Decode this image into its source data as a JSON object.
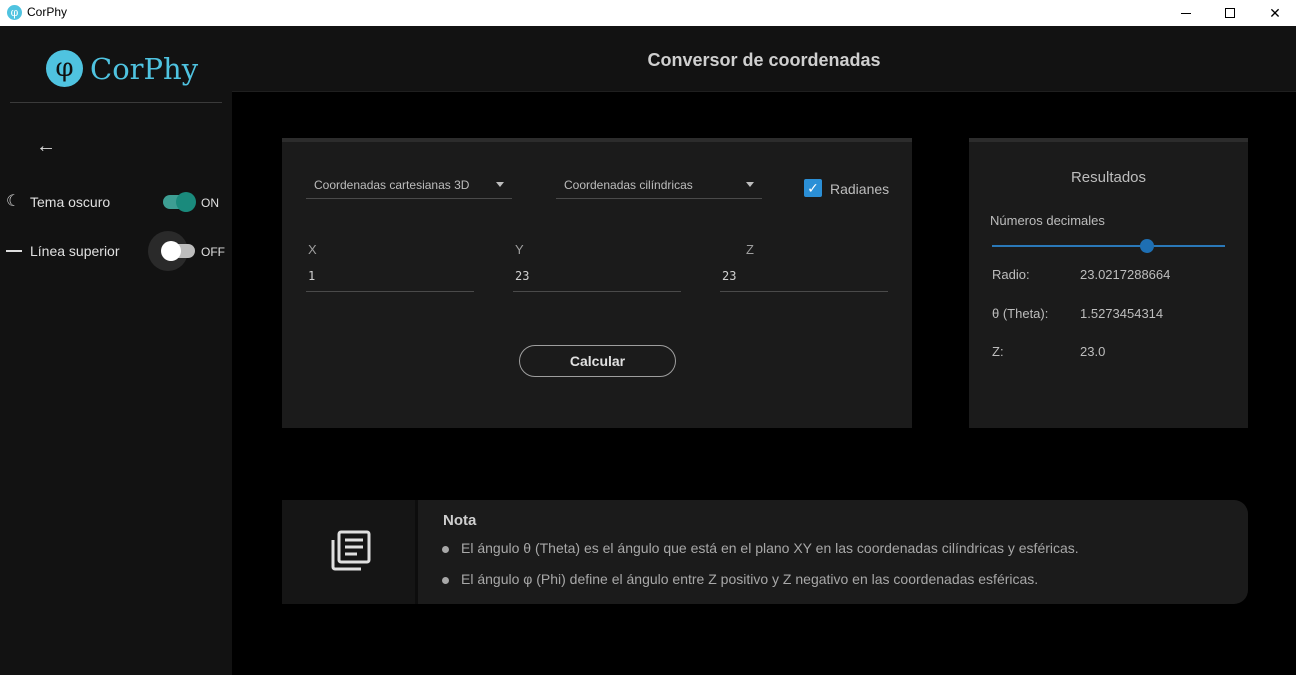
{
  "window": {
    "title": "CorPhy",
    "icon_glyph": "φ",
    "minimize_icon": "minimize-icon",
    "maximize_icon": "maximize-icon",
    "close_glyph": "✕"
  },
  "sidebar": {
    "logo_glyph": "φ",
    "logo_text": "CorPhy",
    "back_glyph": "←",
    "theme": {
      "icon_glyph": "☾",
      "label": "Tema oscuro",
      "state": "ON",
      "on": true
    },
    "top_line": {
      "label": "Línea superior",
      "state": "OFF",
      "on": false
    }
  },
  "header": {
    "title": "Conversor de coordenadas"
  },
  "converter": {
    "from_select": "Coordenadas cartesianas 3D",
    "to_select": "Coordenadas cilíndricas",
    "radians_label": "Radianes",
    "radians_checked": true,
    "check_glyph": "✓",
    "fields": [
      {
        "label": "X",
        "value": "1"
      },
      {
        "label": "Y",
        "value": "23"
      },
      {
        "label": "Z",
        "value": "23"
      }
    ],
    "calculate_label": "Calcular"
  },
  "results": {
    "title": "Resultados",
    "slider_label": "Números decimales",
    "slider_fraction": 0.66,
    "rows": [
      {
        "key": "Radio:",
        "value": "23.0217288664"
      },
      {
        "key": "θ (Theta):",
        "value": "1.5273454314"
      },
      {
        "key": "Z:",
        "value": "23.0"
      }
    ]
  },
  "note": {
    "title": "Nota",
    "items": [
      "El ángulo θ (Theta) es el ángulo que está en el plano XY en las coordenadas cilíndricas y esféricas.",
      "El ángulo φ (Phi) define el ángulo entre Z positivo y Z negativo en las coordenadas esféricas."
    ]
  },
  "colors": {
    "accent": "#4fc3e0",
    "switch_on": "#1a8a7c",
    "checkbox": "#2b8fd6",
    "slider": "#1e6fb3"
  }
}
